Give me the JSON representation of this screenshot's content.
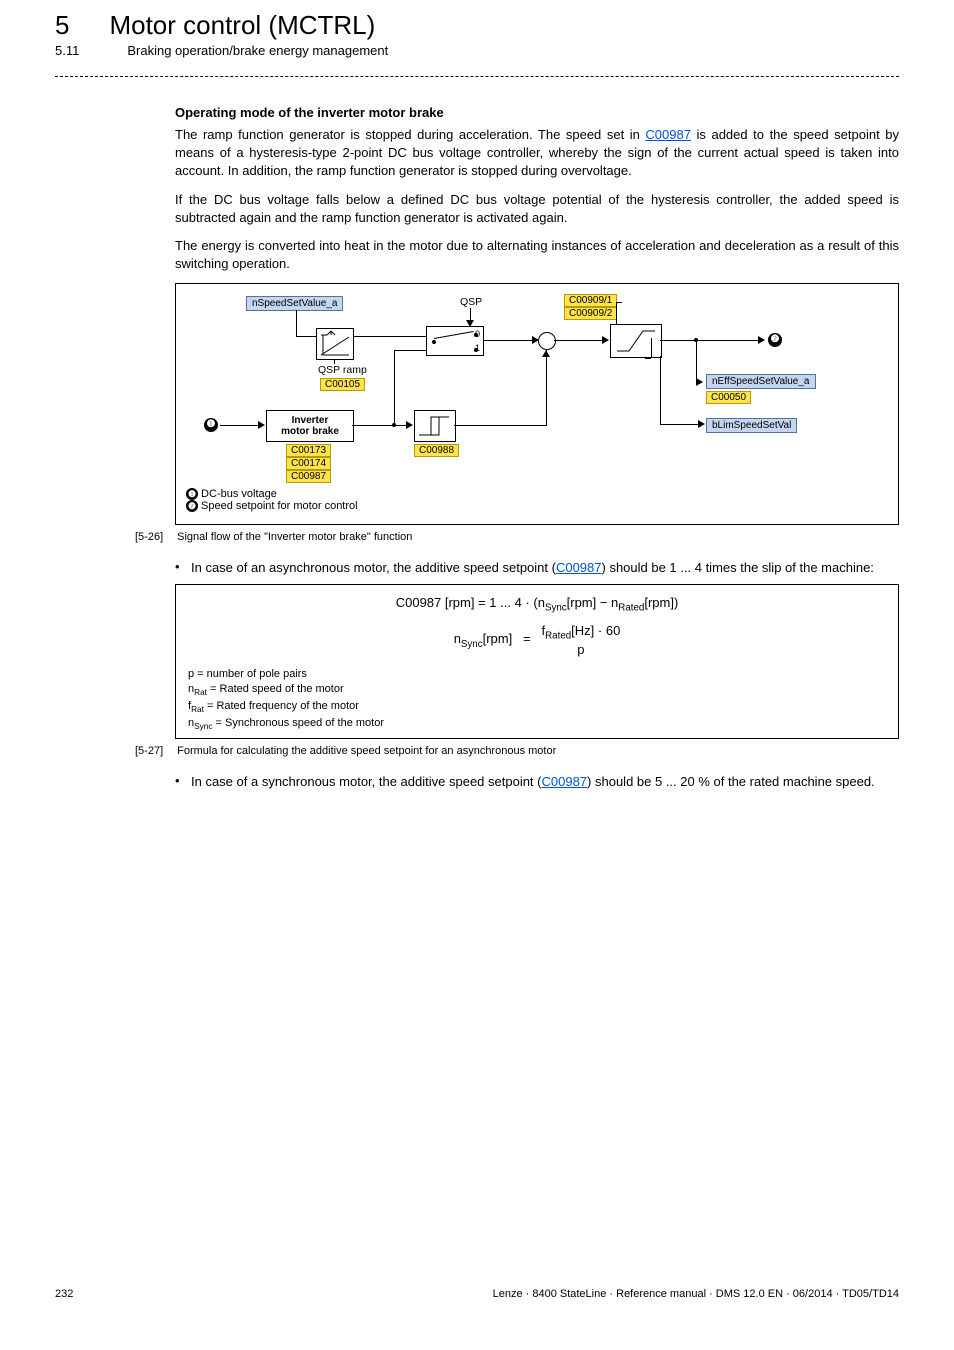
{
  "header": {
    "chapter_num": "5",
    "chapter_title": "Motor control (MCTRL)",
    "section_num": "5.11",
    "section_title": "Braking operation/brake energy management"
  },
  "section_heading": "Operating mode of the inverter motor brake",
  "para1_a": "The ramp function generator is stopped during acceleration. The speed set in ",
  "para1_link": "C00987",
  "para1_b": " is added to the speed setpoint by means of a hysteresis-type 2-point DC bus voltage controller, whereby the sign of the current actual speed is taken into account. In addition, the ramp function generator is stopped during overvoltage.",
  "para2": "If the DC bus voltage falls below a defined DC bus voltage potential of the hysteresis controller, the added speed is subtracted again and the ramp function generator is activated again.",
  "para3": "The energy is converted into heat in the motor due to alternating instances of acceleration and deceleration as a result of this switching operation.",
  "diagram": {
    "nSpeedSetValue": "nSpeedSetValue_a",
    "qsp": "QSP",
    "qsp_ramp": "QSP ramp",
    "qsp_ramp_code": "C00105",
    "c00909_1": "C00909/1",
    "c00909_2": "C00909/2",
    "inverter_brake_top": "Inverter",
    "inverter_brake_bot": "motor brake",
    "inv_codes_1": "C00173",
    "inv_codes_2": "C00174",
    "inv_codes_3": "C00987",
    "c00988": "C00988",
    "nEff": "nEffSpeedSetValue_a",
    "nEff_code": "C00050",
    "bLim": "bLimSpeedSetVal",
    "sw_0": "0",
    "sw_1": "1",
    "legend1": " DC-bus voltage",
    "legend2": " Speed setpoint for motor control"
  },
  "caption1_num": "[5-26]",
  "caption1_txt": "Signal flow of the \"Inverter motor brake\" function",
  "bullet1_a": "In case of an asynchronous motor, the additive speed setpoint (",
  "bullet1_link": "C00987",
  "bullet1_b": ") should be 1 ... 4 times the slip of the machine:",
  "formula": {
    "line1": "C00987 [rpm]   =   1 ... 4 · (n",
    "line1_sub1": "Sync",
    "line1_mid": "[rpm] − n",
    "line1_sub2": "Rated",
    "line1_end": "[rpm])",
    "n_sync": "n",
    "n_sync_sub": "Sync",
    "n_sync_unit": "[rpm]",
    "eq": "=",
    "f_rated": "f",
    "f_rated_sub": "Rated",
    "hz60": "[Hz] · 60",
    "p": "p",
    "def_p": "p = number of pole pairs",
    "def_nrat_a": "n",
    "def_nrat_sub": "Rat",
    "def_nrat_b": " = Rated speed of the motor",
    "def_frat_a": "f",
    "def_frat_sub": "Rat",
    "def_frat_b": " = Rated frequency of the motor",
    "def_nsync_a": "n",
    "def_nsync_sub": "Sync",
    "def_nsync_b": " = Synchronous speed of the motor"
  },
  "caption2_num": "[5-27]",
  "caption2_txt": "Formula for calculating the additive speed setpoint for an asynchronous motor",
  "bullet2_a": "In case of a synchronous motor, the additive speed setpoint (",
  "bullet2_link": "C00987",
  "bullet2_b": ") should be 5 ... 20 % of the rated machine speed.",
  "footer_page": "232",
  "footer_right": "Lenze · 8400 StateLine · Reference manual · DMS 12.0 EN · 06/2014 · TD05/TD14"
}
